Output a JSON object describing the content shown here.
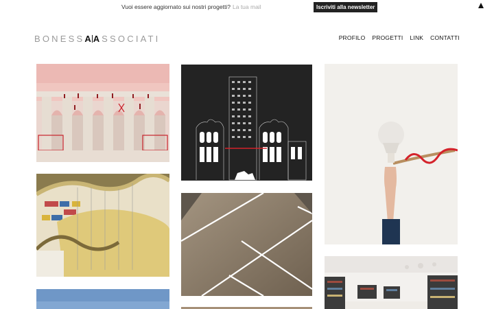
{
  "newsletter": {
    "prompt": "Vuoi essere aggiornato sui nostri progetti?",
    "input_placeholder": "La tua mail",
    "button_label": "Iscriviti alla newsletter"
  },
  "logo": {
    "left": "BONESS",
    "mark_a1": "A",
    "mark_a2": "A",
    "right": "SSOCIATI"
  },
  "nav": {
    "items": [
      {
        "label": "PROFILO"
      },
      {
        "label": "PROGETTI"
      },
      {
        "label": "LINK"
      },
      {
        "label": "CONTATTI"
      }
    ]
  },
  "gallery": {
    "tiles": [
      {
        "name": "pink-arcade-drawing"
      },
      {
        "name": "black-facade-elevation"
      },
      {
        "name": "hand-with-lamp"
      },
      {
        "name": "library-curved-balcony"
      },
      {
        "name": "ceiling-light-lines"
      },
      {
        "name": "bookstore-interior"
      },
      {
        "name": "blue-sky-photo"
      }
    ]
  },
  "colors": {
    "accent_red": "#d4232b",
    "logo_grey": "#9a9a9a",
    "button_bg": "#222222"
  }
}
